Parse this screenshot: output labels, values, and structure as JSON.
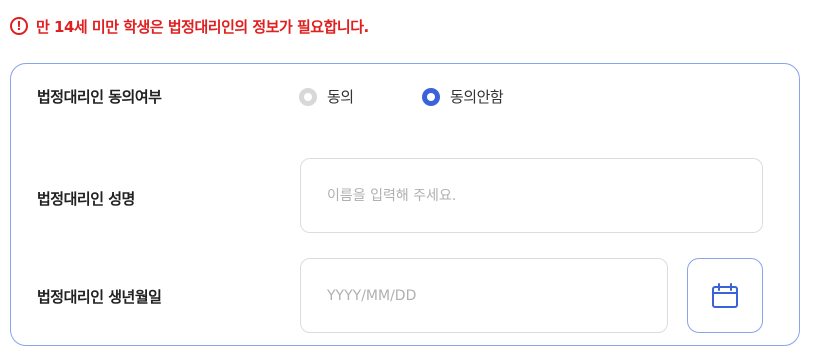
{
  "notice": {
    "icon": "exclamation-circle-icon",
    "icon_glyph": "!",
    "text": "만 14세 미만 학생은 법정대리인의 정보가 필요합니다.",
    "color": "#e02020"
  },
  "form": {
    "border_color": "#8aa4ea",
    "consent": {
      "label": "법정대리인 동의여부",
      "options": [
        {
          "label": "동의",
          "selected": false
        },
        {
          "label": "동의안함",
          "selected": true
        }
      ],
      "accent": "#3b63d9"
    },
    "name": {
      "label": "법정대리인 성명",
      "value": "",
      "placeholder": "이름을 입력해 주세요."
    },
    "birth": {
      "label": "법정대리인 생년월일",
      "value": "",
      "placeholder": "YYYY/MM/DD",
      "calendar_icon": "calendar-icon"
    }
  }
}
